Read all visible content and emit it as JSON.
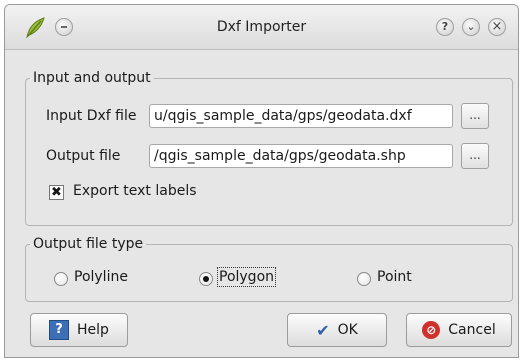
{
  "window": {
    "title": "Dxf Importer",
    "controls": {
      "help": "?",
      "minimize": "⌄",
      "close": "×"
    }
  },
  "io_group": {
    "legend": "Input and output",
    "input_label": "Input Dxf file",
    "input_value": "u/qgis_sample_data/gps/geodata.dxf",
    "output_label": "Output file",
    "output_value": "/qgis_sample_data/gps/geodata.shp",
    "browse_label": "...",
    "export_checked": true,
    "export_mark": "✖",
    "export_label": "Export text labels"
  },
  "type_group": {
    "legend": "Output file type",
    "options": [
      {
        "label": "Polyline",
        "checked": false
      },
      {
        "label": "Polygon",
        "checked": true
      },
      {
        "label": "Point",
        "checked": false
      }
    ]
  },
  "buttons": {
    "help": "Help",
    "ok": "OK",
    "cancel": "Cancel"
  },
  "icons": {
    "app": "qgis-leaf-icon",
    "help": "help-book-icon",
    "ok": "checkmark-icon",
    "cancel": "cancel-icon"
  }
}
